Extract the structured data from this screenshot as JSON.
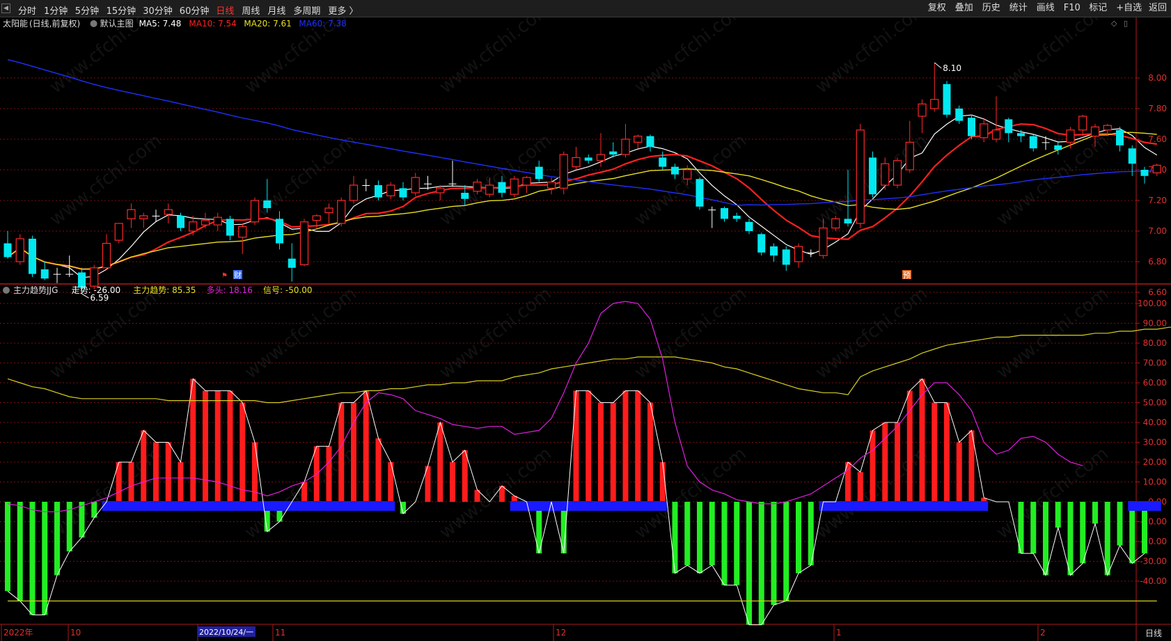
{
  "toolbar": {
    "periods": [
      "分时",
      "1分钟",
      "5分钟",
      "15分钟",
      "30分钟",
      "60分钟",
      "日线",
      "周线",
      "月线",
      "多周期",
      "更多 〉"
    ],
    "active_period": "日线",
    "right_buttons": [
      "复权",
      "叠加",
      "历史",
      "统计",
      "画线",
      "F10",
      "标记",
      "+自选",
      "返回"
    ]
  },
  "main_panel": {
    "stock_name": "太阳能",
    "mode": "(日线,前复权)",
    "template": "默认主图",
    "ma": [
      {
        "label": "MA5",
        "value": "7.48",
        "color": "#ffffff"
      },
      {
        "label": "MA10",
        "value": "7.54",
        "color": "#ff2020"
      },
      {
        "label": "MA20",
        "value": "7.61",
        "color": "#e8e020"
      },
      {
        "label": "MA60",
        "value": "7.38",
        "color": "#2030ff"
      }
    ],
    "high_label": "8.10",
    "low_label": "6.59",
    "markers": [
      "财",
      "预"
    ]
  },
  "indicator_panel": {
    "name": "主力趋势JJG",
    "fields": [
      {
        "label": "走势",
        "value": "-26.00",
        "color": "#ffffff"
      },
      {
        "label": "主力趋势",
        "value": "85.35",
        "color": "#e8e020"
      },
      {
        "label": "多头",
        "value": "18.16",
        "color": "#e020e0"
      },
      {
        "label": "信号",
        "value": "-50.00",
        "color": "#e8e020"
      }
    ]
  },
  "date_axis": {
    "labels": [
      "2022年",
      "10",
      "2022/10/24/一",
      "11",
      "12",
      "1",
      "2"
    ],
    "period_button": "日线"
  },
  "watermark": "www.cfchi.com",
  "chart_data": {
    "type": "candlestick",
    "price_axis": {
      "ylim": [
        6.5,
        8.25
      ],
      "ticks": [
        6.6,
        6.8,
        7.0,
        7.2,
        7.4,
        7.6,
        7.8,
        8.0
      ]
    },
    "candles": [
      {
        "o": 6.92,
        "h": 7.0,
        "l": 6.82,
        "c": 6.83
      },
      {
        "o": 6.8,
        "h": 6.98,
        "l": 6.78,
        "c": 6.95
      },
      {
        "o": 6.95,
        "h": 6.97,
        "l": 6.7,
        "c": 6.72
      },
      {
        "o": 6.75,
        "h": 6.8,
        "l": 6.68,
        "c": 6.69
      },
      {
        "o": 6.72,
        "h": 6.76,
        "l": 6.66,
        "c": 6.72
      },
      {
        "o": 6.72,
        "h": 6.84,
        "l": 6.7,
        "c": 6.72
      },
      {
        "o": 6.73,
        "h": 6.76,
        "l": 6.59,
        "c": 6.63
      },
      {
        "o": 6.64,
        "h": 6.78,
        "l": 6.62,
        "c": 6.76
      },
      {
        "o": 6.76,
        "h": 6.98,
        "l": 6.75,
        "c": 6.92
      },
      {
        "o": 6.94,
        "h": 7.05,
        "l": 6.92,
        "c": 7.05
      },
      {
        "o": 7.08,
        "h": 7.18,
        "l": 7.02,
        "c": 7.14
      },
      {
        "o": 7.08,
        "h": 7.12,
        "l": 7.02,
        "c": 7.1
      },
      {
        "o": 7.1,
        "h": 7.14,
        "l": 7.06,
        "c": 7.1
      },
      {
        "o": 7.11,
        "h": 7.18,
        "l": 7.05,
        "c": 7.14
      },
      {
        "o": 7.1,
        "h": 7.12,
        "l": 7.0,
        "c": 7.02
      },
      {
        "o": 7.0,
        "h": 7.1,
        "l": 6.97,
        "c": 7.06
      },
      {
        "o": 7.04,
        "h": 7.12,
        "l": 7.02,
        "c": 7.07
      },
      {
        "o": 7.04,
        "h": 7.12,
        "l": 7.0,
        "c": 7.09
      },
      {
        "o": 7.08,
        "h": 7.1,
        "l": 6.94,
        "c": 6.97
      },
      {
        "o": 6.96,
        "h": 7.05,
        "l": 6.85,
        "c": 7.03
      },
      {
        "o": 7.06,
        "h": 7.22,
        "l": 7.04,
        "c": 7.2
      },
      {
        "o": 7.2,
        "h": 7.34,
        "l": 7.12,
        "c": 7.15
      },
      {
        "o": 7.08,
        "h": 7.13,
        "l": 6.88,
        "c": 6.92
      },
      {
        "o": 6.82,
        "h": 6.92,
        "l": 6.67,
        "c": 6.76
      },
      {
        "o": 6.78,
        "h": 7.08,
        "l": 6.77,
        "c": 7.06
      },
      {
        "o": 7.07,
        "h": 7.11,
        "l": 7.02,
        "c": 7.1
      },
      {
        "o": 7.12,
        "h": 7.18,
        "l": 7.05,
        "c": 7.15
      },
      {
        "o": 7.05,
        "h": 7.22,
        "l": 7.03,
        "c": 7.2
      },
      {
        "o": 7.2,
        "h": 7.36,
        "l": 7.18,
        "c": 7.3
      },
      {
        "o": 7.3,
        "h": 7.34,
        "l": 7.26,
        "c": 7.3
      },
      {
        "o": 7.3,
        "h": 7.33,
        "l": 7.2,
        "c": 7.22
      },
      {
        "o": 7.23,
        "h": 7.32,
        "l": 7.21,
        "c": 7.3
      },
      {
        "o": 7.28,
        "h": 7.32,
        "l": 7.2,
        "c": 7.22
      },
      {
        "o": 7.25,
        "h": 7.38,
        "l": 7.23,
        "c": 7.35
      },
      {
        "o": 7.31,
        "h": 7.36,
        "l": 7.27,
        "c": 7.31
      },
      {
        "o": 7.25,
        "h": 7.3,
        "l": 7.2,
        "c": 7.28
      },
      {
        "o": 7.31,
        "h": 7.46,
        "l": 7.29,
        "c": 7.31
      },
      {
        "o": 7.25,
        "h": 7.3,
        "l": 7.17,
        "c": 7.21
      },
      {
        "o": 7.26,
        "h": 7.34,
        "l": 7.24,
        "c": 7.32
      },
      {
        "o": 7.24,
        "h": 7.35,
        "l": 7.22,
        "c": 7.3
      },
      {
        "o": 7.32,
        "h": 7.36,
        "l": 7.22,
        "c": 7.25
      },
      {
        "o": 7.24,
        "h": 7.36,
        "l": 7.22,
        "c": 7.34
      },
      {
        "o": 7.3,
        "h": 7.36,
        "l": 7.25,
        "c": 7.35
      },
      {
        "o": 7.42,
        "h": 7.46,
        "l": 7.32,
        "c": 7.34
      },
      {
        "o": 7.28,
        "h": 7.35,
        "l": 7.24,
        "c": 7.32
      },
      {
        "o": 7.28,
        "h": 7.52,
        "l": 7.24,
        "c": 7.5
      },
      {
        "o": 7.42,
        "h": 7.55,
        "l": 7.4,
        "c": 7.48
      },
      {
        "o": 7.48,
        "h": 7.5,
        "l": 7.44,
        "c": 7.46
      },
      {
        "o": 7.46,
        "h": 7.64,
        "l": 7.42,
        "c": 7.5
      },
      {
        "o": 7.52,
        "h": 7.58,
        "l": 7.48,
        "c": 7.5
      },
      {
        "o": 7.5,
        "h": 7.7,
        "l": 7.48,
        "c": 7.6
      },
      {
        "o": 7.58,
        "h": 7.63,
        "l": 7.54,
        "c": 7.62
      },
      {
        "o": 7.62,
        "h": 7.63,
        "l": 7.52,
        "c": 7.55
      },
      {
        "o": 7.48,
        "h": 7.52,
        "l": 7.4,
        "c": 7.42
      },
      {
        "o": 7.42,
        "h": 7.44,
        "l": 7.34,
        "c": 7.37
      },
      {
        "o": 7.34,
        "h": 7.43,
        "l": 7.3,
        "c": 7.4
      },
      {
        "o": 7.34,
        "h": 7.35,
        "l": 7.14,
        "c": 7.16
      },
      {
        "o": 7.14,
        "h": 7.16,
        "l": 7.02,
        "c": 7.14
      },
      {
        "o": 7.15,
        "h": 7.16,
        "l": 7.06,
        "c": 7.08
      },
      {
        "o": 7.1,
        "h": 7.12,
        "l": 7.06,
        "c": 7.08
      },
      {
        "o": 7.06,
        "h": 7.08,
        "l": 6.98,
        "c": 7.0
      },
      {
        "o": 6.98,
        "h": 6.99,
        "l": 6.84,
        "c": 6.86
      },
      {
        "o": 6.9,
        "h": 6.92,
        "l": 6.8,
        "c": 6.84
      },
      {
        "o": 6.88,
        "h": 6.9,
        "l": 6.74,
        "c": 6.78
      },
      {
        "o": 6.8,
        "h": 6.92,
        "l": 6.76,
        "c": 6.9
      },
      {
        "o": 6.86,
        "h": 6.88,
        "l": 6.83,
        "c": 6.86
      },
      {
        "o": 6.84,
        "h": 7.08,
        "l": 6.82,
        "c": 7.02
      },
      {
        "o": 7.02,
        "h": 7.1,
        "l": 7.0,
        "c": 7.08
      },
      {
        "o": 7.08,
        "h": 7.4,
        "l": 7.03,
        "c": 7.05
      },
      {
        "o": 7.05,
        "h": 7.7,
        "l": 7.02,
        "c": 7.66
      },
      {
        "o": 7.48,
        "h": 7.52,
        "l": 7.22,
        "c": 7.24
      },
      {
        "o": 7.3,
        "h": 7.48,
        "l": 7.27,
        "c": 7.44
      },
      {
        "o": 7.3,
        "h": 7.48,
        "l": 7.28,
        "c": 7.46
      },
      {
        "o": 7.4,
        "h": 7.72,
        "l": 7.38,
        "c": 7.58
      },
      {
        "o": 7.75,
        "h": 7.86,
        "l": 7.64,
        "c": 7.83
      },
      {
        "o": 7.8,
        "h": 8.1,
        "l": 7.78,
        "c": 7.86
      },
      {
        "o": 7.96,
        "h": 7.98,
        "l": 7.74,
        "c": 7.76
      },
      {
        "o": 7.8,
        "h": 7.82,
        "l": 7.7,
        "c": 7.72
      },
      {
        "o": 7.74,
        "h": 7.76,
        "l": 7.6,
        "c": 7.62
      },
      {
        "o": 7.61,
        "h": 7.74,
        "l": 7.58,
        "c": 7.7
      },
      {
        "o": 7.6,
        "h": 7.88,
        "l": 7.58,
        "c": 7.66
      },
      {
        "o": 7.73,
        "h": 7.74,
        "l": 7.58,
        "c": 7.64
      },
      {
        "o": 7.64,
        "h": 7.66,
        "l": 7.58,
        "c": 7.62
      },
      {
        "o": 7.62,
        "h": 7.63,
        "l": 7.52,
        "c": 7.54
      },
      {
        "o": 7.58,
        "h": 7.62,
        "l": 7.53,
        "c": 7.58
      },
      {
        "o": 7.56,
        "h": 7.58,
        "l": 7.5,
        "c": 7.53
      },
      {
        "o": 7.58,
        "h": 7.68,
        "l": 7.54,
        "c": 7.66
      },
      {
        "o": 7.66,
        "h": 7.76,
        "l": 7.62,
        "c": 7.75
      },
      {
        "o": 7.62,
        "h": 7.7,
        "l": 7.55,
        "c": 7.68
      },
      {
        "o": 7.66,
        "h": 7.7,
        "l": 7.62,
        "c": 7.69
      },
      {
        "o": 7.66,
        "h": 7.68,
        "l": 7.52,
        "c": 7.56
      },
      {
        "o": 7.54,
        "h": 7.56,
        "l": 7.36,
        "c": 7.44
      },
      {
        "o": 7.4,
        "h": 7.42,
        "l": 7.31,
        "c": 7.36
      },
      {
        "o": 7.38,
        "h": 7.44,
        "l": 7.36,
        "c": 7.43
      }
    ],
    "ma_periods": [
      5,
      10,
      20,
      60
    ],
    "ma60_first_value": 8.12,
    "indicator_axis": {
      "ylim": [
        -55,
        103
      ],
      "ticks": [
        100,
        90,
        80,
        70,
        60,
        50,
        40,
        30,
        20,
        10,
        0,
        -10,
        -20,
        -30,
        -40
      ]
    },
    "trend_histogram": [
      -45,
      -50,
      -57,
      -57,
      -37,
      -25,
      -18,
      -8,
      0,
      20,
      20,
      36,
      30,
      30,
      20,
      62,
      56,
      56,
      56,
      50,
      30,
      -15,
      -10,
      0,
      10,
      28,
      28,
      50,
      50,
      56,
      32,
      20,
      -6,
      0,
      18,
      40,
      20,
      26,
      6,
      0,
      8,
      3,
      0,
      -26,
      0,
      -26,
      56,
      56,
      50,
      50,
      56,
      56,
      50,
      20,
      -36,
      -32,
      -36,
      -32,
      -42,
      -42,
      -62,
      -62,
      -52,
      -50,
      -36,
      -32,
      0,
      0,
      20,
      15,
      36,
      40,
      40,
      56,
      62,
      50,
      50,
      30,
      36,
      2,
      0,
      0,
      -26,
      -26,
      -37,
      -13,
      -37,
      -31,
      -11,
      -37,
      -22,
      -31,
      -26
    ],
    "trend_line": [
      -45,
      -50,
      -57,
      -57,
      -37,
      -25,
      -18,
      -8,
      0,
      20,
      20,
      36,
      30,
      30,
      20,
      62,
      56,
      56,
      56,
      50,
      30,
      -15,
      -10,
      0,
      10,
      28,
      28,
      50,
      50,
      56,
      32,
      20,
      -6,
      0,
      18,
      40,
      20,
      26,
      6,
      0,
      8,
      3,
      0,
      -26,
      0,
      -26,
      56,
      56,
      50,
      50,
      56,
      56,
      50,
      20,
      -36,
      -32,
      -36,
      -32,
      -42,
      -42,
      -62,
      -62,
      -52,
      -50,
      -36,
      -32,
      0,
      0,
      20,
      15,
      36,
      40,
      40,
      56,
      62,
      50,
      50,
      30,
      36,
      2,
      0,
      0,
      -26,
      -26,
      -37,
      -13,
      -37,
      -31,
      -11,
      -37,
      -22,
      -31,
      -26
    ],
    "main_trend_line": [
      62,
      60,
      58,
      57,
      55,
      53,
      52,
      52,
      52,
      52,
      52,
      52,
      52,
      51,
      51,
      51,
      51,
      51,
      51,
      51,
      51,
      50,
      50,
      51,
      52,
      53,
      54,
      55,
      55,
      56,
      56,
      57,
      57,
      58,
      59,
      59,
      60,
      60,
      61,
      61,
      61,
      63,
      64,
      65,
      67,
      68,
      69,
      70,
      71,
      72,
      72,
      73,
      73,
      73,
      73,
      72,
      71,
      70,
      68,
      67,
      65,
      63,
      61,
      59,
      57,
      56,
      55,
      55,
      54,
      63,
      66,
      68,
      70,
      72,
      75,
      77,
      79,
      80,
      81,
      82,
      83,
      83,
      84,
      84,
      84,
      84,
      84,
      84,
      85,
      85,
      86,
      86,
      87,
      87,
      88,
      88,
      88,
      87,
      86,
      85.35
    ],
    "bull_line": [
      -1,
      -2,
      -4,
      -5,
      -5,
      -4,
      -2,
      0,
      2,
      5,
      8,
      10,
      12,
      12,
      12,
      12,
      11,
      10,
      8,
      6,
      5,
      3,
      5,
      8,
      10,
      14,
      20,
      28,
      40,
      50,
      55,
      54,
      52,
      46,
      44,
      42,
      39,
      38,
      37,
      38,
      38,
      34,
      35,
      36,
      42,
      55,
      70,
      80,
      95,
      100,
      101,
      100,
      92,
      72,
      40,
      18,
      10,
      6,
      4,
      1,
      0,
      -1,
      -1,
      0,
      2,
      4,
      8,
      12,
      16,
      22,
      26,
      32,
      38,
      46,
      54,
      60,
      60,
      54,
      46,
      30,
      24,
      26,
      32,
      33,
      30,
      24,
      20,
      18.16
    ],
    "signal_line": -50
  }
}
